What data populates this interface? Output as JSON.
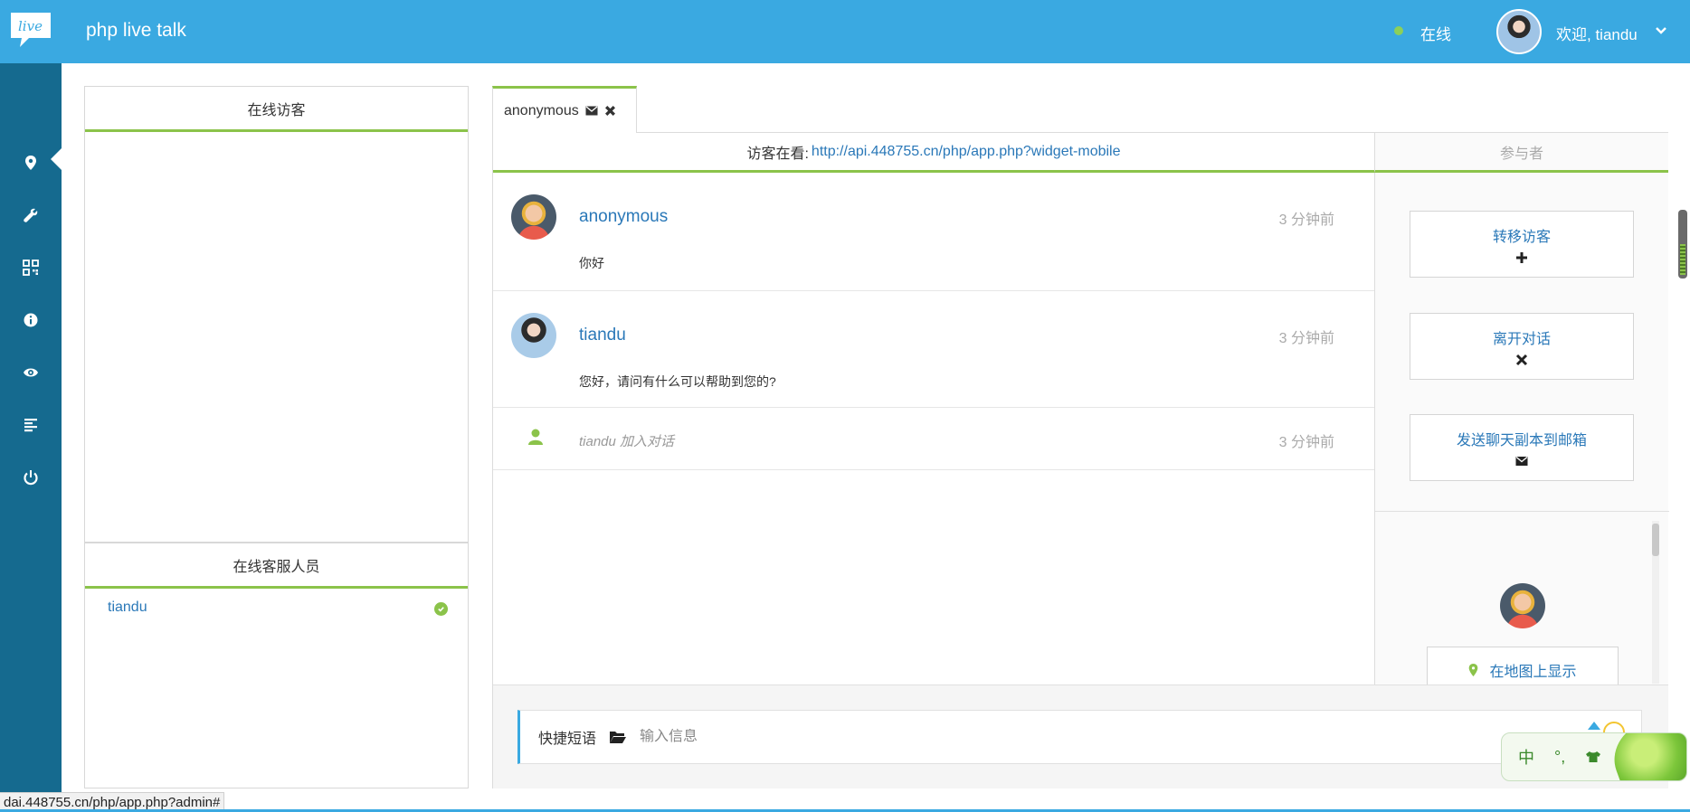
{
  "header": {
    "logo_text": "live",
    "app_title": "php live talk",
    "status_text": "在线",
    "welcome_text": "欢迎, tiandu"
  },
  "sidebar": {
    "items": [
      {
        "icon": "map-marker-icon"
      },
      {
        "icon": "wrench-icon"
      },
      {
        "icon": "qrcode-icon"
      },
      {
        "icon": "info-icon"
      },
      {
        "icon": "eye-icon"
      },
      {
        "icon": "align-left-icon"
      },
      {
        "icon": "power-icon"
      }
    ]
  },
  "left_panels": {
    "visitors_title": "在线访客",
    "staff_title": "在线客服人员",
    "staff": [
      {
        "name": "tiandu",
        "online": true
      }
    ]
  },
  "chat": {
    "tab_label": "anonymous",
    "viewing_label": "访客在看:",
    "viewing_url": "http://api.448755.cn/php/app.php?widget-mobile",
    "participants_title": "参与者",
    "messages": [
      {
        "name": "anonymous",
        "time": "3 分钟前",
        "text": "你好"
      },
      {
        "name": "tiandu",
        "time": "3 分钟前",
        "text": "您好，请问有什么可以帮助到您的?"
      }
    ],
    "system_message": {
      "text": "tiandu 加入对话",
      "time": "3 分钟前"
    },
    "actions": {
      "transfer": "转移访客",
      "leave": "离开对话",
      "email": "发送聊天副本到邮箱"
    },
    "map_button": "在地图上显示",
    "input": {
      "quick_phrases_label": "快捷短语",
      "placeholder": "输入信息"
    }
  },
  "ime": {
    "lang": "中",
    "punct": "°,"
  },
  "status_bar": {
    "url": "dai.448755.cn/php/app.php?admin#"
  },
  "colors": {
    "header_bg": "#3aa9e1",
    "sidebar_bg": "#156a8f",
    "accent_green": "#8bc34a",
    "link_blue": "#2a78b8"
  }
}
